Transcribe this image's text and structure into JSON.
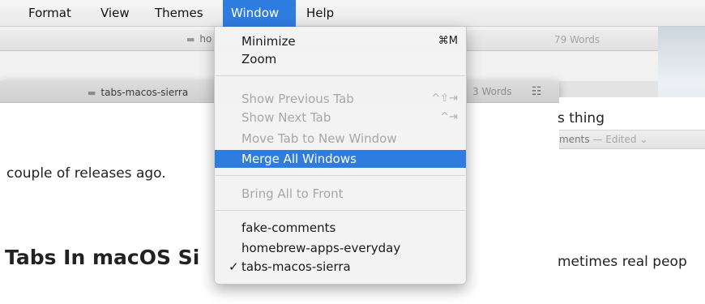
{
  "menubar": {
    "items": [
      {
        "label": "Format"
      },
      {
        "label": "View"
      },
      {
        "label": "Themes"
      },
      {
        "label": "Window"
      },
      {
        "label": "Help"
      }
    ]
  },
  "back_window": {
    "title": "ho",
    "words": "79 Words"
  },
  "main_window": {
    "tab_title": "tabs-macos-sierra",
    "words": "3 Words",
    "list_icon": "☷",
    "paragraph": "couple of releases ago.",
    "heading": "Tabs In macOS Si"
  },
  "right_window": {
    "line1": "s thing",
    "title": "ments",
    "edited": " — Edited ⌄",
    "line2": "metimes real peop"
  },
  "window_menu": {
    "minimize": {
      "label": "Minimize",
      "shortcut": "⌘M"
    },
    "zoom": {
      "label": "Zoom"
    },
    "show_previous_tab": {
      "label": "Show Previous Tab",
      "shortcut": "^⇧⇥"
    },
    "show_next_tab": {
      "label": "Show Next Tab",
      "shortcut": "^⇥"
    },
    "move_tab": {
      "label": "Move Tab to New Window"
    },
    "merge_all": {
      "label": "Merge All Windows"
    },
    "bring_all_front": {
      "label": "Bring All to Front"
    },
    "documents": [
      {
        "label": "fake-comments",
        "checked": ""
      },
      {
        "label": "homebrew-apps-everyday",
        "checked": ""
      },
      {
        "label": "tabs-macos-sierra",
        "checked": "✓"
      }
    ]
  },
  "colors": {
    "highlight": "#2f7ce1",
    "disabled_text": "#a7a7a7"
  }
}
